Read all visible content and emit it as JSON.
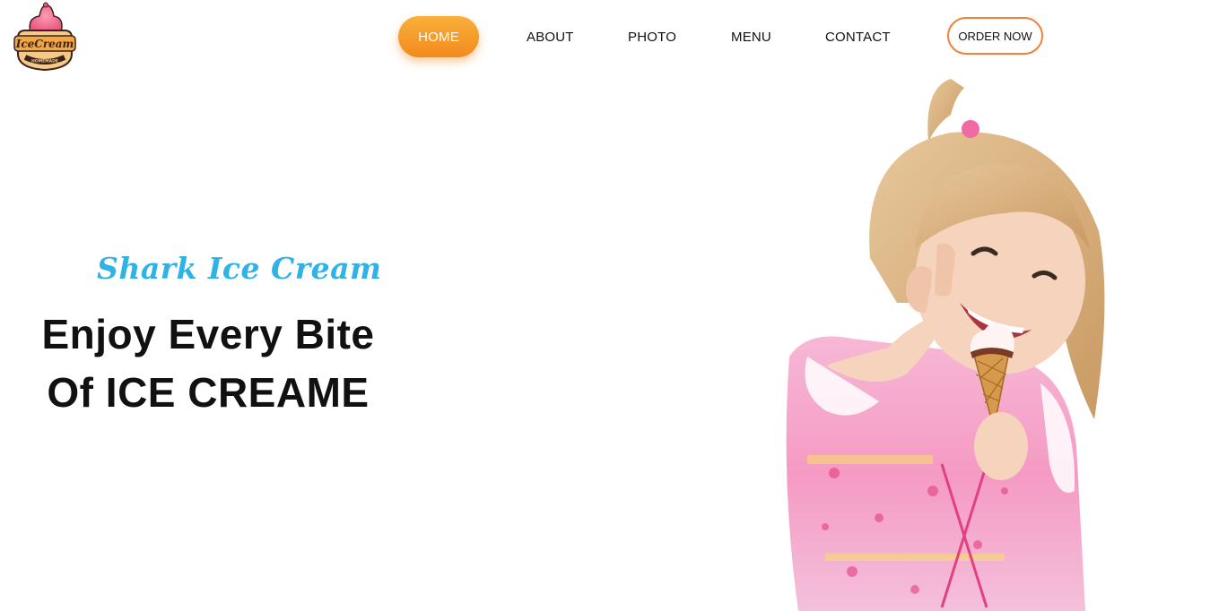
{
  "brand": {
    "logo_text": "IceCream",
    "logo_subtext": "HOMEMADE",
    "logo_icon": "ice-cream-cone-icon"
  },
  "nav": {
    "items": [
      {
        "label": "HOME",
        "active": true
      },
      {
        "label": "ABOUT"
      },
      {
        "label": "PHOTO"
      },
      {
        "label": "MENU"
      },
      {
        "label": "CONTACT"
      }
    ],
    "order_label": "ORDER NOW"
  },
  "hero": {
    "tagline": "Shark Ice Cream",
    "title_line1": "Enjoy Every Bite",
    "title_line2": "Of ICE CREAME"
  },
  "colors": {
    "accent_orange": "#f28a1e",
    "tagline_blue": "#2fb3e6",
    "order_border": "#f0813a"
  }
}
